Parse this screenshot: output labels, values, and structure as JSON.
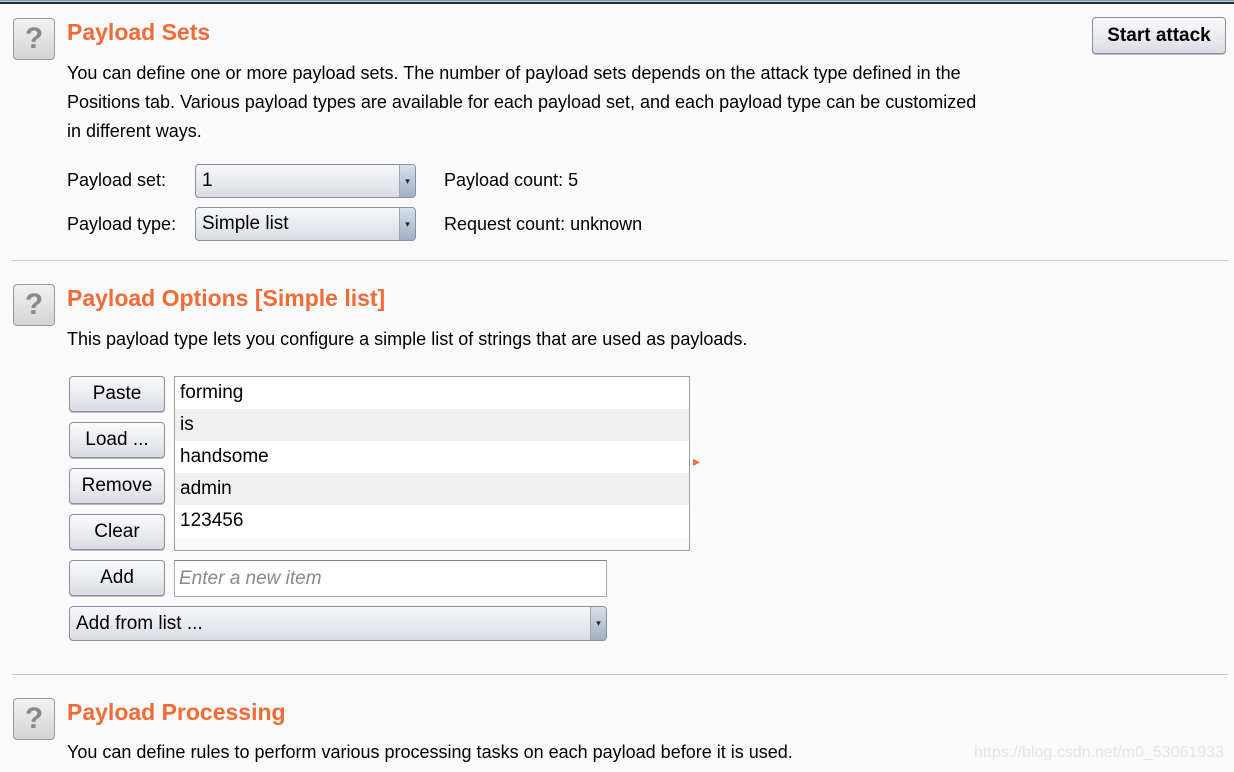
{
  "sets": {
    "title": "Payload Sets",
    "start_attack": "Start attack",
    "desc": [
      "You can define one or more payload sets. The number of payload sets depends on the attack type defined in the",
      "Positions tab. Various payload types are available for each payload set, and each payload type can be customized",
      "in different ways."
    ],
    "set_label": "Payload set:",
    "set_value": "1",
    "count": "Payload count: 5",
    "type_label": "Payload type:",
    "type_value": "Simple list",
    "request_count": "Request count: unknown"
  },
  "options": {
    "title": "Payload Options [Simple list]",
    "desc": "This payload type lets you configure a simple list of strings that are used as payloads.",
    "buttons": {
      "paste": "Paste",
      "load": "Load ...",
      "remove": "Remove",
      "clear": "Clear",
      "add": "Add"
    },
    "items": [
      "forming",
      "is",
      "handsome",
      "admin",
      "123456"
    ],
    "new_item_placeholder": "Enter a new item",
    "add_from_list": "Add from list ..."
  },
  "processing": {
    "title": "Payload Processing",
    "desc": "You can define rules to perform various processing tasks on each payload before it is used."
  },
  "icons": {
    "help": "?",
    "dropdown": "▾",
    "expand": "▸"
  },
  "accent_color": "#f26a35",
  "watermark": "https://blog.csdn.net/m0_53061933"
}
